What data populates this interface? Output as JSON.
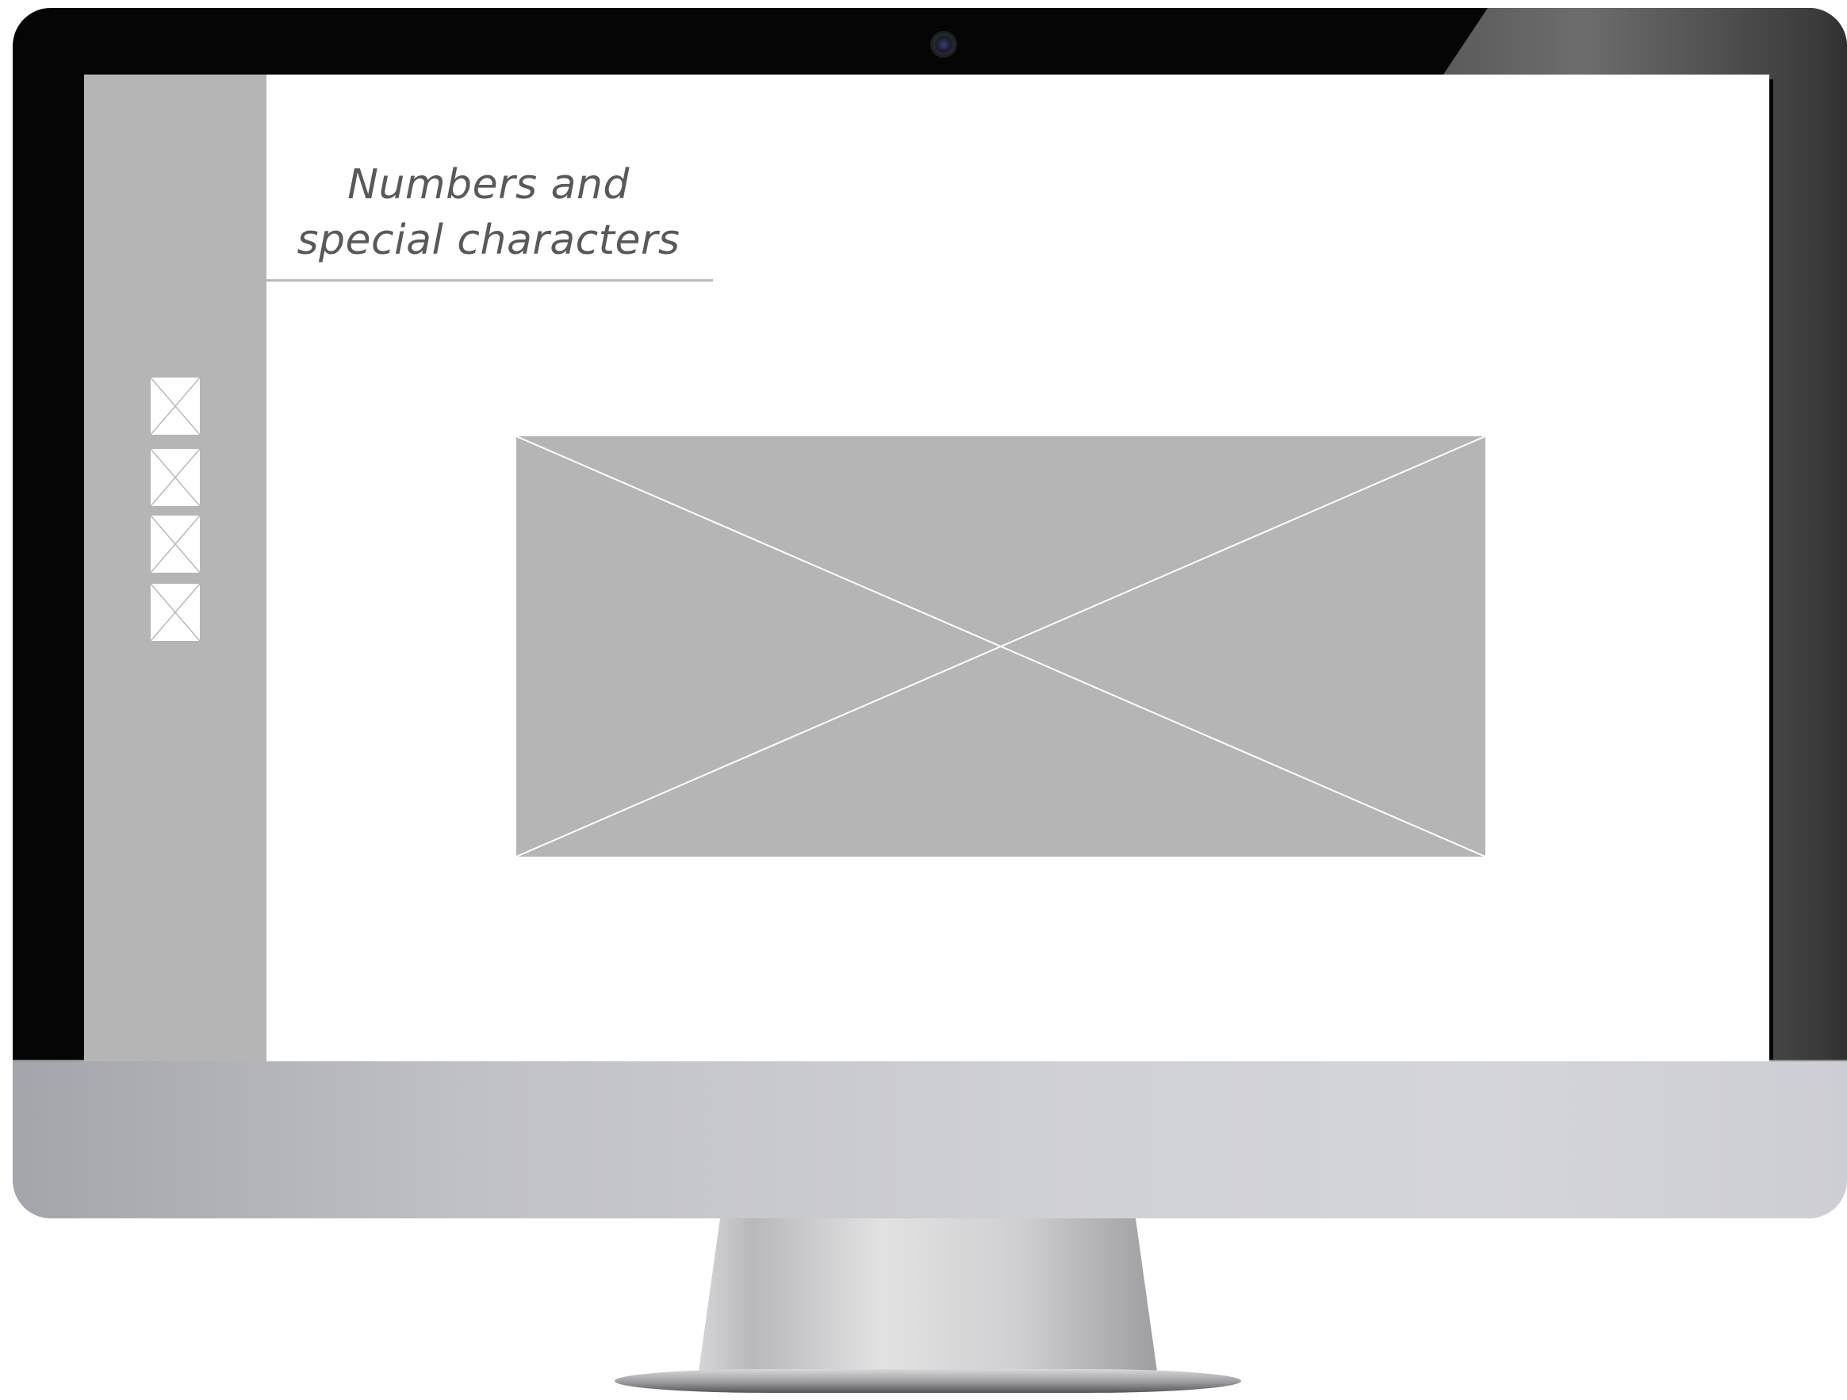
{
  "page": {
    "title_line1": "Numbers and",
    "title_line2": "special characters"
  },
  "sidebar": {
    "items": [
      {
        "icon": "image-placeholder-icon"
      },
      {
        "icon": "image-placeholder-icon"
      },
      {
        "icon": "image-placeholder-icon"
      },
      {
        "icon": "image-placeholder-icon"
      }
    ]
  },
  "main": {
    "hero": {
      "icon": "image-placeholder-icon"
    }
  },
  "colors": {
    "sidebar_bg": "#b5b5b5",
    "placeholder_bg": "#b5b5b5",
    "title_text": "#58595b",
    "bezel": "#050505",
    "chin": "#c9cacf"
  }
}
